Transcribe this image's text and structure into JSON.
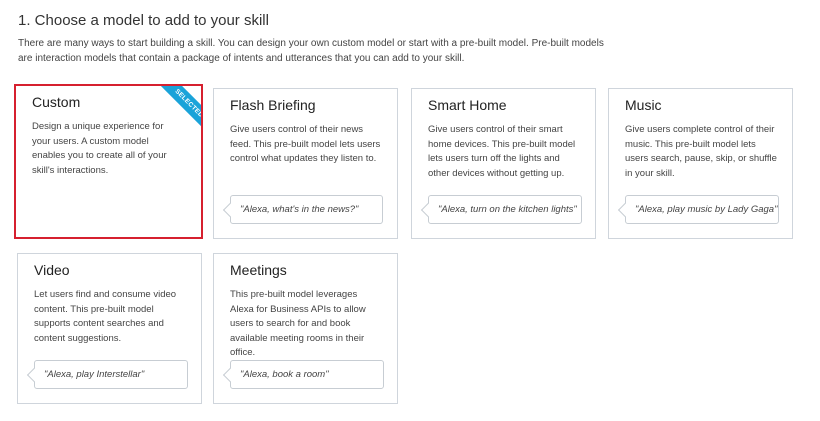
{
  "section": {
    "title": "1. Choose a model to add to your skill",
    "description": "There are many ways to start building a skill. You can design your own custom model or start with a pre-built model.  Pre-built models are interaction models that contain a package of intents and utterances that you can add to your skill."
  },
  "models": [
    {
      "title": "Custom",
      "description": "Design a unique experience for your users. A custom model enables you to create all of your skill's interactions.",
      "example": "",
      "selected": true,
      "badge": "SELECTED"
    },
    {
      "title": "Flash Briefing",
      "description": "Give users control of their news feed. This pre-built model lets users control what updates they listen to.",
      "example": "\"Alexa, what's in the news?\""
    },
    {
      "title": "Smart Home",
      "description": "Give users control of their smart home devices. This pre-built model lets users turn off the lights and other devices without getting up.",
      "example": "\"Alexa, turn on the kitchen lights\""
    },
    {
      "title": "Music",
      "description": "Give users complete control of their music. This pre-built model lets users search, pause, skip, or shuffle in your skill.",
      "example": "\"Alexa, play music by Lady Gaga\""
    },
    {
      "title": "Video",
      "description": "Let users find and consume video content. This pre-built model supports content searches and content suggestions.",
      "example": "\"Alexa, play Interstellar\""
    },
    {
      "title": "Meetings",
      "description": "This pre-built model leverages Alexa for Business APIs to allow users to search for and book available meeting rooms in their office.",
      "example": "\"Alexa, book a room\""
    }
  ],
  "colors": {
    "selected_border": "#d6202f",
    "badge_background": "#1aa3d9",
    "card_border": "#cfd5dc"
  }
}
